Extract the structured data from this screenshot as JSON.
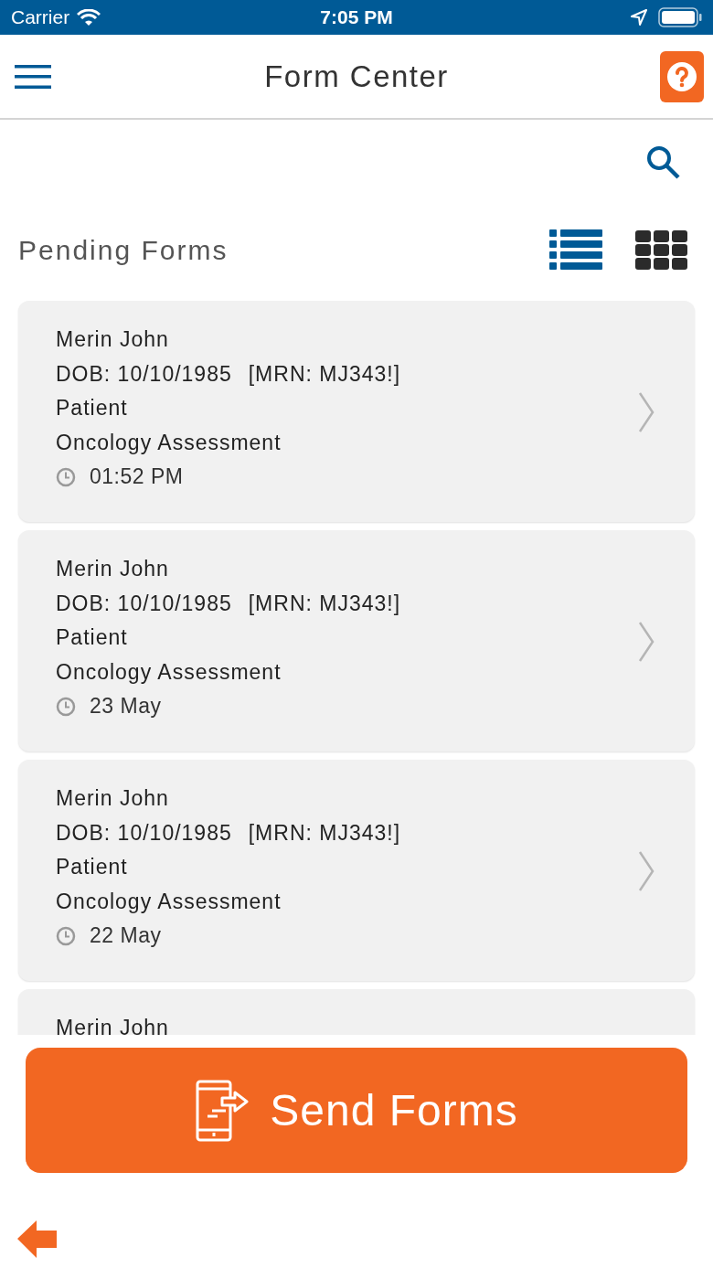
{
  "status_bar": {
    "carrier": "Carrier",
    "time": "7:05 PM"
  },
  "header": {
    "title": "Form Center"
  },
  "section": {
    "title": "Pending Forms"
  },
  "views": [
    {
      "kind": "list",
      "selected": true
    },
    {
      "kind": "grid",
      "selected": false
    }
  ],
  "forms": [
    {
      "name": "Merin John",
      "dob": "DOB: 10/10/1985",
      "mrn": "[MRN: MJ343!]",
      "role": "Patient",
      "form": "Oncology Assessment",
      "time": "01:52 PM"
    },
    {
      "name": "Merin John",
      "dob": "DOB: 10/10/1985",
      "mrn": "[MRN: MJ343!]",
      "role": "Patient",
      "form": "Oncology Assessment",
      "time": "23 May"
    },
    {
      "name": "Merin John",
      "dob": "DOB: 10/10/1985",
      "mrn": "[MRN: MJ343!]",
      "role": "Patient",
      "form": "Oncology Assessment",
      "time": "22 May"
    },
    {
      "name": "Merin John"
    }
  ],
  "send_button": {
    "label": "Send Forms"
  }
}
